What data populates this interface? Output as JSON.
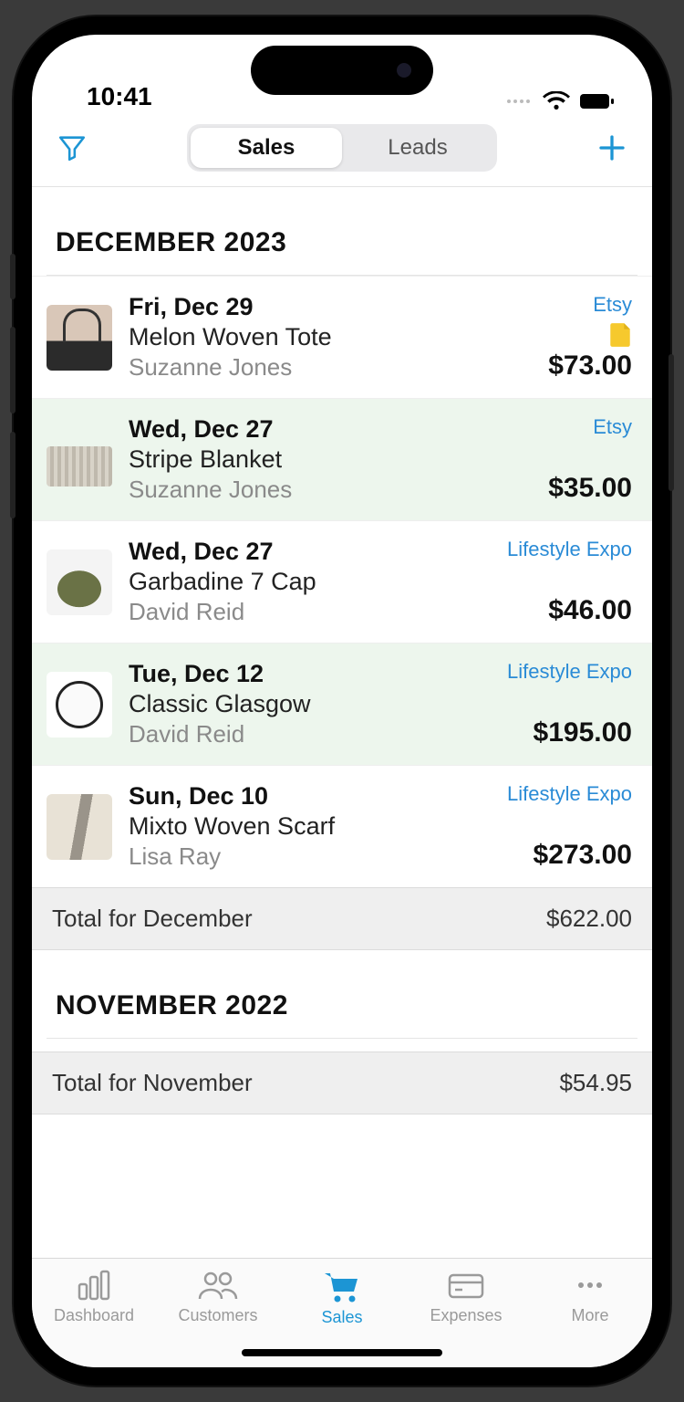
{
  "status": {
    "time": "10:41"
  },
  "topbar": {
    "tabs": {
      "sales": "Sales",
      "leads": "Leads"
    }
  },
  "sections": [
    {
      "title": "DECEMBER 2023",
      "rows": [
        {
          "date": "Fri, Dec 29",
          "product": "Melon Woven Tote",
          "customer": "Suzanne Jones",
          "source": "Etsy",
          "amount": "$73.00",
          "has_note": true,
          "alt": false,
          "thumb": "tote"
        },
        {
          "date": "Wed, Dec 27",
          "product": "Stripe Blanket",
          "customer": "Suzanne Jones",
          "source": "Etsy",
          "amount": "$35.00",
          "has_note": false,
          "alt": true,
          "thumb": "blanket"
        },
        {
          "date": "Wed, Dec 27",
          "product": "Garbadine 7 Cap",
          "customer": "David Reid",
          "source": "Lifestyle Expo",
          "amount": "$46.00",
          "has_note": false,
          "alt": false,
          "thumb": "cap"
        },
        {
          "date": "Tue, Dec 12",
          "product": "Classic Glasgow",
          "customer": "David Reid",
          "source": "Lifestyle Expo",
          "amount": "$195.00",
          "has_note": false,
          "alt": true,
          "thumb": "watch"
        },
        {
          "date": "Sun, Dec 10",
          "product": "Mixto Woven Scarf",
          "customer": "Lisa Ray",
          "source": "Lifestyle Expo",
          "amount": "$273.00",
          "has_note": false,
          "alt": false,
          "thumb": "scarf"
        }
      ],
      "total_label": "Total for December",
      "total_amount": "$622.00"
    },
    {
      "title": "NOVEMBER 2022",
      "rows": [],
      "total_label": "Total for November",
      "total_amount": "$54.95"
    }
  ],
  "tabbar": {
    "dashboard": "Dashboard",
    "customers": "Customers",
    "sales": "Sales",
    "expenses": "Expenses",
    "more": "More"
  }
}
